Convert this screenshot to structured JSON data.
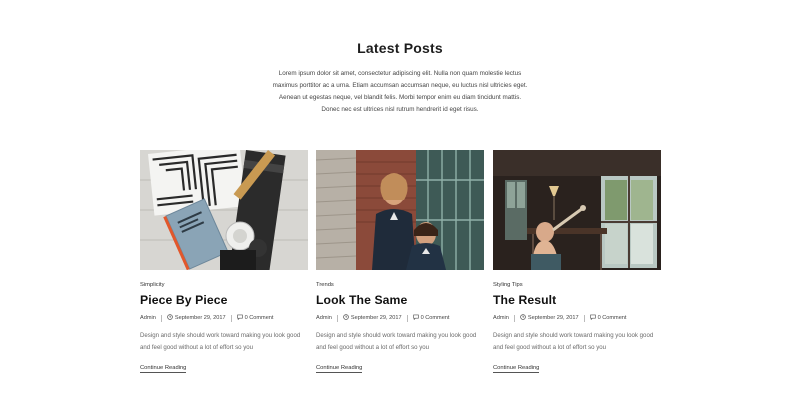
{
  "section": {
    "title": "Latest Posts",
    "intro_lines": [
      "Lorem ipsum dolor sit amet, consectetur adipiscing elit. Nulla non quam molestie lectus",
      "maximus porttitor ac a urna. Etiam accumsan accumsan neque, eu luctus nisl ultricies eget.",
      "Aenean ut egestas neque, vel blandit felis. Morbi tempor enim eu diam tincidunt mattis.",
      "Donec nec est ultrices nisl rutrum hendrerit id eget risus."
    ]
  },
  "posts": [
    {
      "category": "Simplicity",
      "title": "Piece By Piece",
      "author": "Admin",
      "date": "September 29, 2017",
      "comments": "0 Comment",
      "excerpt": "Design and style should work toward making you look good and feel good without a lot of effort so you",
      "read_more": "Continue Reading"
    },
    {
      "category": "Trends",
      "title": "Look The Same",
      "author": "Admin",
      "date": "September 29, 2017",
      "comments": "0 Comment",
      "excerpt": "Design and style should work toward making you look good and feel good without a lot of effort so you",
      "read_more": "Continue Reading"
    },
    {
      "category": "Styling Tips",
      "title": "The Result",
      "author": "Admin",
      "date": "September 29, 2017",
      "comments": "0 Comment",
      "excerpt": "Design and style should work toward making you look good and feel good without a lot of effort so you",
      "read_more": "Continue Reading"
    }
  ],
  "icons": {
    "date": "clock-icon",
    "comments": "comment-icon"
  }
}
